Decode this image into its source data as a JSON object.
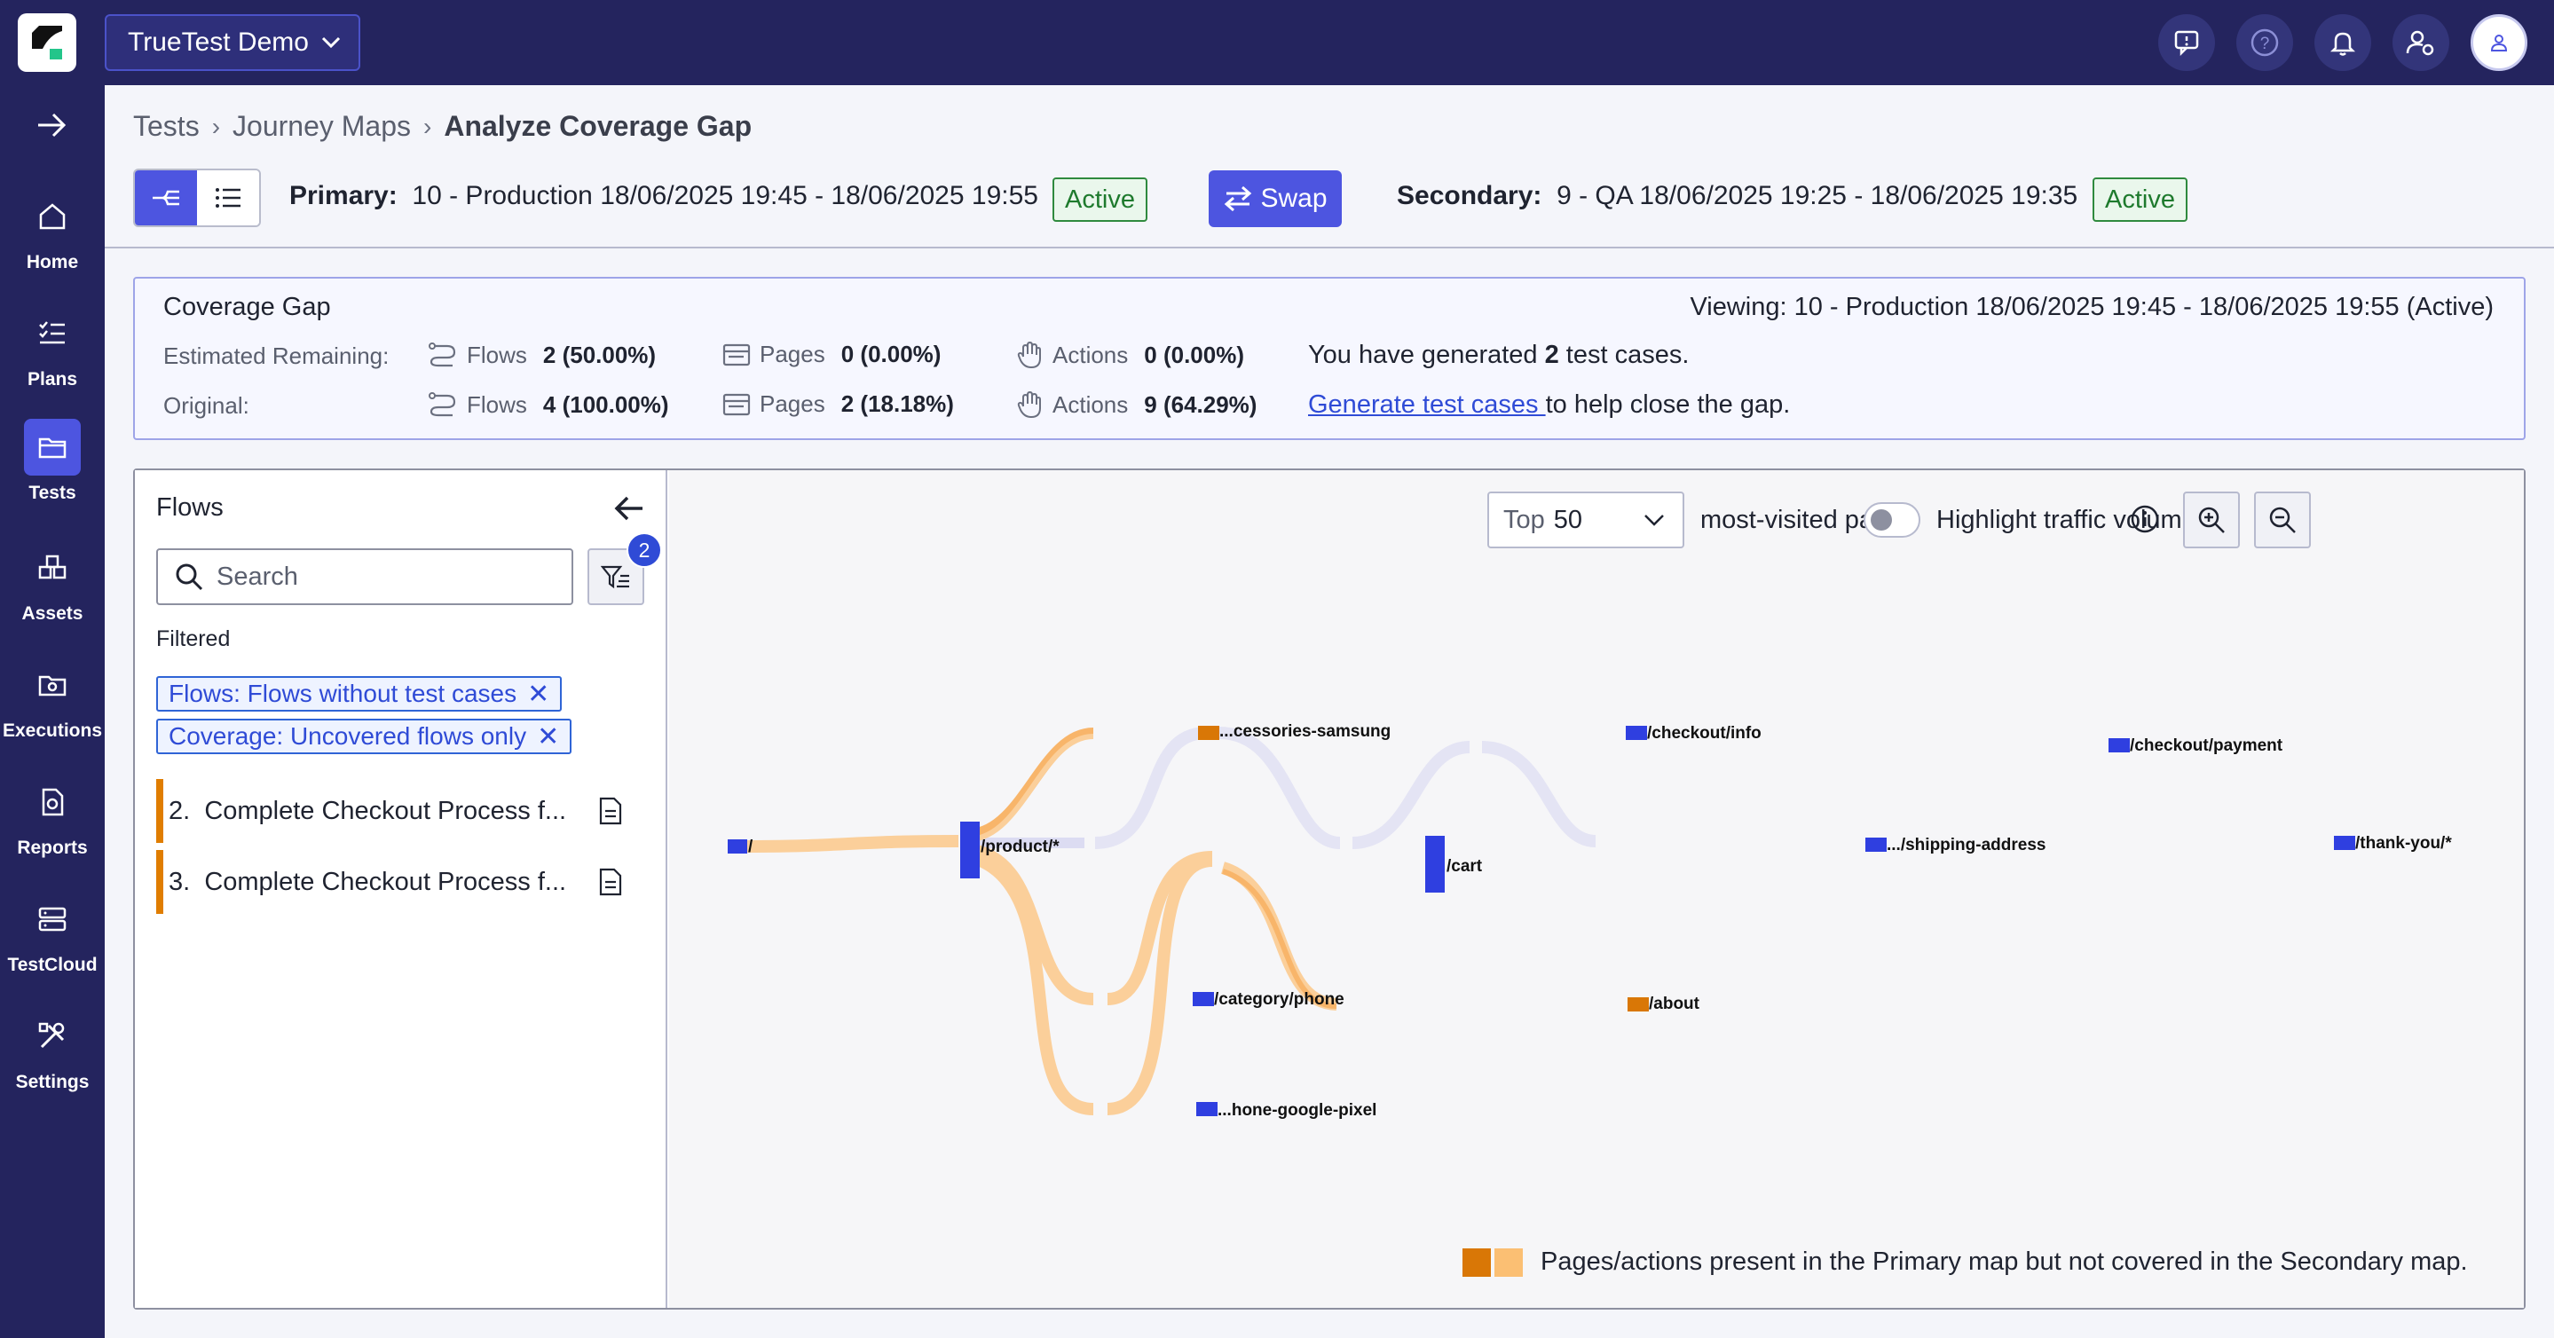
{
  "header": {
    "project": "TrueTest Demo"
  },
  "sidebar": {
    "items": [
      {
        "label": "Home"
      },
      {
        "label": "Plans"
      },
      {
        "label": "Tests"
      },
      {
        "label": "Assets"
      },
      {
        "label": "Executions"
      },
      {
        "label": "Reports"
      },
      {
        "label": "TestCloud"
      },
      {
        "label": "Settings"
      }
    ],
    "active": "Tests"
  },
  "breadcrumb": {
    "items": [
      "Tests",
      "Journey Maps",
      "Analyze Coverage Gap"
    ]
  },
  "compare": {
    "primary_label": "Primary:",
    "primary_value": "10 - Production 18/06/2025 19:45 - 18/06/2025 19:55",
    "primary_status": "Active",
    "swap_label": "Swap",
    "secondary_label": "Secondary:",
    "secondary_value": "9 - QA 18/06/2025 19:25 - 18/06/2025 19:35",
    "secondary_status": "Active"
  },
  "coverage_gap": {
    "title": "Coverage Gap",
    "viewing": "Viewing: 10 - Production 18/06/2025 19:45 - 18/06/2025 19:55 (Active)",
    "estimated_label": "Estimated Remaining:",
    "original_label": "Original:",
    "flows_label": "Flows",
    "pages_label": "Pages",
    "actions_label": "Actions",
    "estimated": {
      "flows": "2 (50.00%)",
      "pages": "0 (0.00%)",
      "actions": "0 (0.00%)"
    },
    "original": {
      "flows": "4 (100.00%)",
      "pages": "2 (18.18%)",
      "actions": "9 (64.29%)"
    },
    "generated_pre": "You have generated ",
    "generated_count": "2",
    "generated_post": " test cases.",
    "generate_link": "Generate test cases ",
    "generate_post": "to help close the gap."
  },
  "flows_panel": {
    "title": "Flows",
    "search_placeholder": "Search",
    "filter_count": "2",
    "filtered_label": "Filtered",
    "chips": [
      "Flows: Flows without test cases",
      "Coverage: Uncovered flows only"
    ],
    "items": [
      {
        "index": "2.",
        "label": "Complete Checkout Process f..."
      },
      {
        "index": "3.",
        "label": "Complete Checkout Process f..."
      }
    ]
  },
  "map": {
    "top_select": {
      "prefix": "Top",
      "value": "50"
    },
    "most_visited_label": "most-visited pages",
    "highlight_label": "Highlight traffic volume",
    "highlight_on": false,
    "nodes": [
      "/",
      "/product/*",
      "...cessories-samsung",
      "/category/phone",
      "...hone-google-pixel",
      "/cart",
      "/about",
      "/checkout/info",
      ".../shipping-address",
      "/checkout/payment",
      "/thank-you/*"
    ],
    "legend_text": "Pages/actions present in the Primary map but not covered in the Secondary map."
  },
  "colors": {
    "nav_bg": "#24245e",
    "accent": "#4d55e0",
    "node_blue": "#2f3fe0",
    "uncovered_dark": "#d97706",
    "uncovered_light": "#fbbf73",
    "covered_link": "#dcdcf2",
    "active_green": "#1e7a2d"
  }
}
